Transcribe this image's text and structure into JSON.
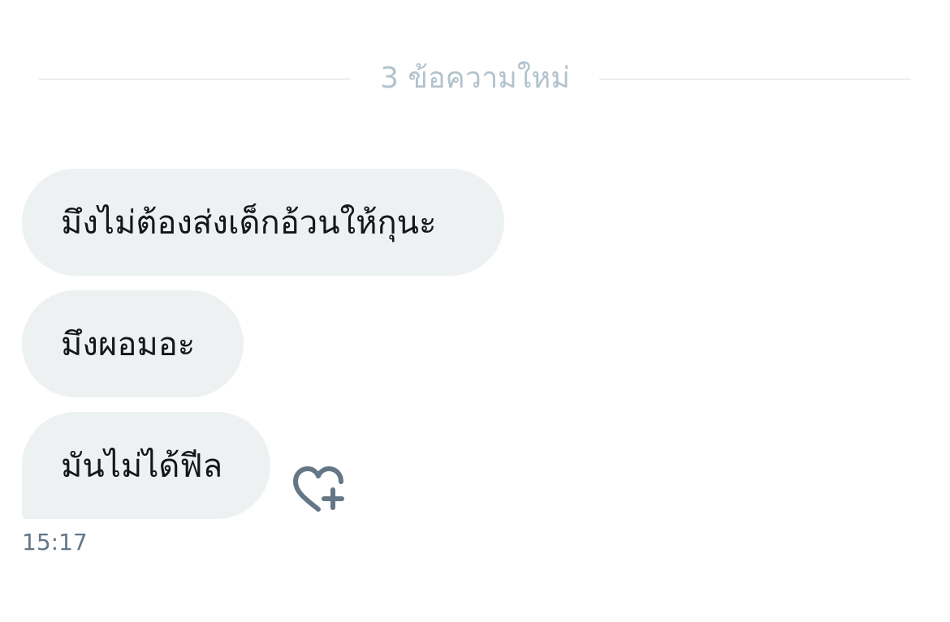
{
  "divider": {
    "label": "3 ข้อความใหม่"
  },
  "messages": [
    {
      "text": "มึงไม่ต้องส่งเด็กอ้วนให้กุนะ"
    },
    {
      "text": "มึงผอมอะ"
    },
    {
      "text": "มันไม่ได้ฟีล"
    }
  ],
  "last_message": {
    "time": "15:17",
    "reaction_icon": "heart-plus-icon"
  },
  "colors": {
    "bubble_bg": "#eef1f2",
    "text": "#14171a",
    "muted": "#657786",
    "divider_text": "#b3c3cd"
  }
}
